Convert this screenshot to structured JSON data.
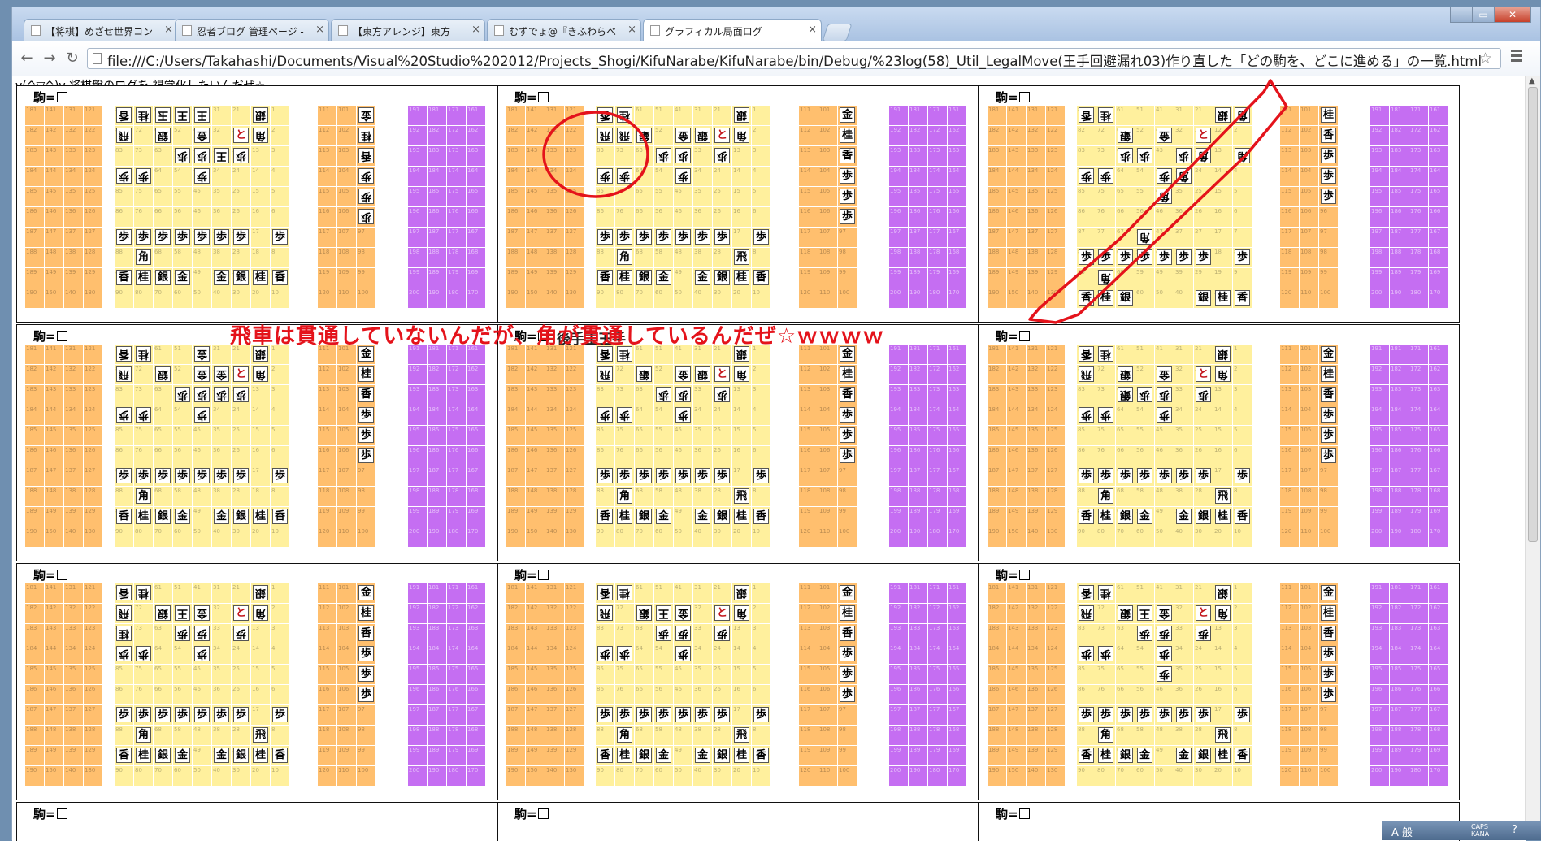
{
  "tabs": [
    {
      "label": "【将棋】めざせ世界コン",
      "active": false
    },
    {
      "label": "忍者ブログ 管理ページ -",
      "active": false
    },
    {
      "label": "【東方アレンジ】東方",
      "active": false
    },
    {
      "label": "むずでょ@『きふわらべ",
      "active": false
    },
    {
      "label": "グラフィカル局面ログ",
      "active": true
    }
  ],
  "address_bar": {
    "url": "file:///C:/Users/Takahashi/Documents/Visual%20Studio%202012/Projects_Shogi/KifuNarabe/KifuNarabe/bin/Debug/%23log(58)_Util_LegalMove(王手回避漏れ03)作り直した「どの駒を、どこに進める」の一覧.html"
  },
  "page": {
    "heading": "v(^▽^)v 将棋盤のログを 視覚化したいんだぜ☆",
    "annotation_text": "飛車は貫通していないんだが、角が貫通しているんだぜ☆ｗｗｗｗ",
    "koma_label": "駒=",
    "turn_label": "後手王王手"
  },
  "tray": {
    "ime": "A 般",
    "caps": "CAPS",
    "kana": "KANA",
    "help": "?"
  },
  "theme": {
    "orange": "#ffbf6e",
    "yellow": "#fff09d",
    "purple": "#c56ef2",
    "annotation_red": "#e4131b"
  },
  "grids": {
    "left_cols": [
      18,
      14,
      13,
      12
    ],
    "mid_cols": [
      11,
      10,
      9
    ],
    "right_cols": [
      19,
      18,
      17,
      16
    ]
  },
  "boards": [
    {
      "rows": [
        [
          "香r",
          "桂r",
          "玉r",
          "王r",
          "王r",
          "",
          "",
          "銀r",
          ""
        ],
        [
          "飛r",
          "",
          "銀r",
          "",
          "金r",
          "",
          "と",
          "角r",
          ""
        ],
        [
          "",
          "",
          "",
          "歩r",
          "歩r",
          "王r",
          "歩r",
          "",
          ""
        ],
        [
          "歩r",
          "歩r",
          "",
          "",
          "歩r",
          "",
          "",
          "",
          ""
        ],
        [
          "",
          "",
          "",
          "",
          "",
          "",
          "",
          "",
          ""
        ],
        [
          "",
          "",
          "",
          "",
          "",
          "",
          "",
          "",
          ""
        ],
        [
          "歩",
          "歩",
          "歩",
          "歩",
          "歩",
          "歩",
          "歩",
          "",
          "歩"
        ],
        [
          "",
          "角",
          "",
          "",
          "",
          "",
          "",
          "",
          ""
        ],
        [
          "香",
          "桂",
          "銀",
          "金",
          "",
          "金",
          "銀",
          "桂",
          "香"
        ]
      ]
    },
    {
      "rows": [
        [
          "香r",
          "桂r",
          "",
          "",
          "",
          "",
          "",
          "銀r",
          ""
        ],
        [
          "飛r",
          "飛r",
          "銀r",
          "",
          "金r",
          "銀r",
          "と",
          "角r",
          ""
        ],
        [
          "",
          "",
          "",
          "歩r",
          "歩r",
          "",
          "歩r",
          "",
          ""
        ],
        [
          "歩r",
          "歩r",
          "",
          "",
          "歩r",
          "",
          "",
          "",
          ""
        ],
        [
          "",
          "",
          "",
          "",
          "",
          "",
          "",
          "",
          ""
        ],
        [
          "",
          "",
          "",
          "",
          "",
          "",
          "",
          "",
          ""
        ],
        [
          "歩",
          "歩",
          "歩",
          "歩",
          "歩",
          "歩",
          "歩",
          "",
          "歩"
        ],
        [
          "",
          "角",
          "",
          "",
          "",
          "",
          "",
          "飛",
          ""
        ],
        [
          "香",
          "桂",
          "銀",
          "金",
          "",
          "金",
          "銀",
          "桂",
          "香"
        ]
      ]
    },
    {
      "rows": [
        [
          "香r",
          "桂r",
          "",
          "",
          "",
          "",
          "",
          "銀r",
          "角r"
        ],
        [
          "",
          "",
          "銀r",
          "",
          "金r",
          "",
          "と",
          "",
          ""
        ],
        [
          "",
          "",
          "歩r",
          "歩r",
          "",
          "歩r",
          "角r",
          "",
          "角r"
        ],
        [
          "歩r",
          "歩r",
          "",
          "",
          "歩r",
          "角r",
          "",
          "",
          ""
        ],
        [
          "",
          "",
          "",
          "",
          "角r",
          "",
          "",
          "",
          ""
        ],
        [
          "",
          "",
          "",
          "",
          "",
          "",
          "",
          "",
          ""
        ],
        [
          "",
          "",
          "",
          "角r",
          "",
          "",
          "",
          "",
          ""
        ],
        [
          "歩",
          "歩",
          "歩",
          "歩",
          "歩",
          "歩",
          "歩",
          "",
          "歩"
        ],
        [
          "",
          "角r",
          "",
          "",
          "",
          "",
          "",
          "",
          ""
        ],
        [
          "香",
          "桂",
          "銀",
          "",
          "",
          "",
          "銀",
          "桂",
          "香"
        ]
      ]
    },
    {
      "rows": [
        [
          "香r",
          "桂r",
          "",
          "",
          "金r",
          "",
          "",
          "銀r",
          ""
        ],
        [
          "飛r",
          "",
          "銀r",
          "",
          "金r",
          "金r",
          "と",
          "角r",
          ""
        ],
        [
          "",
          "",
          "",
          "歩r",
          "歩r",
          "歩r",
          "歩r",
          "",
          ""
        ],
        [
          "歩r",
          "歩r",
          "",
          "",
          "歩r",
          "",
          "",
          "",
          ""
        ],
        [
          "",
          "",
          "",
          "",
          "",
          "",
          "",
          "",
          ""
        ],
        [
          "",
          "",
          "",
          "",
          "",
          "",
          "",
          "",
          ""
        ],
        [
          "歩",
          "歩",
          "歩",
          "歩",
          "歩",
          "歩",
          "歩",
          "",
          "歩"
        ],
        [
          "",
          "角",
          "",
          "",
          "",
          "",
          "",
          "",
          ""
        ],
        [
          "香",
          "桂",
          "銀",
          "金",
          "",
          "金",
          "銀",
          "桂",
          "香"
        ]
      ]
    },
    {
      "rows": [
        [
          "香r",
          "桂r",
          "",
          "",
          "",
          "",
          "",
          "銀r",
          ""
        ],
        [
          "飛r",
          "",
          "銀r",
          "",
          "金r",
          "銀r",
          "と",
          "角r",
          ""
        ],
        [
          "",
          "",
          "",
          "歩r",
          "歩r",
          "",
          "歩r",
          "",
          ""
        ],
        [
          "歩r",
          "歩r",
          "",
          "",
          "歩r",
          "",
          "",
          "",
          ""
        ],
        [
          "",
          "",
          "",
          "",
          "",
          "",
          "",
          "",
          ""
        ],
        [
          "",
          "",
          "",
          "",
          "",
          "",
          "",
          "",
          ""
        ],
        [
          "歩",
          "歩",
          "歩",
          "歩",
          "歩",
          "歩",
          "歩",
          "",
          "歩"
        ],
        [
          "",
          "角",
          "",
          "",
          "",
          "",
          "",
          "飛",
          ""
        ],
        [
          "香",
          "桂",
          "銀",
          "金",
          "",
          "金",
          "銀",
          "桂",
          "香"
        ]
      ]
    },
    {
      "rows": [
        [
          "香r",
          "桂r",
          "",
          "",
          "",
          "",
          "",
          "銀r",
          ""
        ],
        [
          "飛r",
          "",
          "銀r",
          "",
          "金r",
          "",
          "と",
          "角r",
          ""
        ],
        [
          "",
          "",
          "銀r",
          "歩r",
          "歩r",
          "",
          "歩r",
          "",
          ""
        ],
        [
          "歩r",
          "歩r",
          "",
          "",
          "歩r",
          "",
          "",
          "",
          ""
        ],
        [
          "",
          "",
          "",
          "",
          "",
          "",
          "",
          "",
          ""
        ],
        [
          "",
          "",
          "",
          "",
          "",
          "",
          "",
          "",
          ""
        ],
        [
          "歩",
          "歩",
          "歩",
          "歩",
          "歩",
          "歩",
          "歩",
          "",
          "歩"
        ],
        [
          "",
          "角",
          "",
          "",
          "",
          "",
          "",
          "飛",
          ""
        ],
        [
          "香",
          "桂",
          "銀",
          "金",
          "",
          "金",
          "銀",
          "桂",
          "香"
        ]
      ]
    },
    {
      "rows": [
        [
          "香r",
          "桂r",
          "",
          "",
          "",
          "",
          "",
          "銀r",
          ""
        ],
        [
          "飛r",
          "",
          "銀r",
          "王r",
          "金r",
          "",
          "と",
          "角r",
          ""
        ],
        [
          "桂r",
          "",
          "",
          "歩r",
          "歩r",
          "",
          "歩r",
          "",
          ""
        ],
        [
          "歩r",
          "歩r",
          "",
          "",
          "歩r",
          "",
          "",
          "",
          ""
        ],
        [
          "",
          "",
          "",
          "",
          "",
          "",
          "",
          "",
          ""
        ],
        [
          "",
          "",
          "",
          "",
          "",
          "",
          "",
          "",
          ""
        ],
        [
          "歩",
          "歩",
          "歩",
          "歩",
          "歩",
          "歩",
          "歩",
          "",
          "歩"
        ],
        [
          "",
          "角",
          "",
          "",
          "",
          "",
          "",
          "飛",
          ""
        ],
        [
          "香",
          "桂",
          "銀",
          "金",
          "",
          "金",
          "銀",
          "桂",
          "香"
        ]
      ]
    },
    {
      "rows": [
        [
          "香r",
          "桂r",
          "",
          "",
          "",
          "",
          "",
          "銀r",
          ""
        ],
        [
          "飛r",
          "",
          "銀r",
          "王r",
          "金r",
          "",
          "と",
          "角r",
          ""
        ],
        [
          "",
          "",
          "",
          "歩r",
          "歩r",
          "",
          "歩r",
          "",
          ""
        ],
        [
          "歩r",
          "歩r",
          "",
          "",
          "歩r",
          "",
          "",
          "",
          ""
        ],
        [
          "",
          "",
          "",
          "",
          "",
          "",
          "",
          "",
          ""
        ],
        [
          "",
          "",
          "",
          "",
          "",
          "",
          "",
          "",
          ""
        ],
        [
          "歩",
          "歩",
          "歩",
          "歩",
          "歩",
          "歩",
          "歩",
          "",
          "歩"
        ],
        [
          "",
          "角",
          "",
          "",
          "",
          "",
          "",
          "飛",
          ""
        ],
        [
          "香",
          "桂",
          "銀",
          "金",
          "",
          "金",
          "銀",
          "桂",
          "香"
        ]
      ]
    },
    {
      "rows": [
        [
          "香r",
          "桂r",
          "",
          "",
          "",
          "",
          "",
          "銀r",
          ""
        ],
        [
          "飛r",
          "",
          "銀r",
          "王r",
          "金r",
          "",
          "と",
          "角r",
          ""
        ],
        [
          "",
          "",
          "",
          "歩r",
          "歩r",
          "",
          "歩r",
          "",
          ""
        ],
        [
          "歩r",
          "歩r",
          "",
          "",
          "歩r",
          "",
          "",
          "",
          ""
        ],
        [
          "",
          "",
          "",
          "",
          "歩r",
          "",
          "",
          "",
          ""
        ],
        [
          "",
          "",
          "",
          "",
          "",
          "",
          "",
          "",
          ""
        ],
        [
          "歩",
          "歩",
          "歩",
          "歩",
          "歩",
          "歩",
          "歩",
          "",
          "歩"
        ],
        [
          "",
          "角",
          "",
          "",
          "",
          "",
          "",
          "飛",
          ""
        ],
        [
          "香",
          "桂",
          "銀",
          "金",
          "",
          "金",
          "銀",
          "桂",
          "香"
        ]
      ]
    }
  ],
  "left_pieces": [
    {
      "cells": [
        "金r",
        "桂r",
        "香r",
        "歩r",
        "歩r",
        "歩r"
      ]
    },
    {
      "cells": [
        "金",
        "桂",
        "香",
        "歩",
        "歩",
        "歩"
      ]
    },
    {
      "cells": [
        "桂",
        "香",
        "歩",
        "歩",
        "歩"
      ]
    },
    {
      "cells": [
        "金",
        "桂",
        "香",
        "歩",
        "歩",
        "歩"
      ]
    },
    {
      "cells": [
        "金",
        "桂",
        "香",
        "歩",
        "歩",
        "歩"
      ]
    },
    {
      "cells": [
        "金",
        "桂",
        "香",
        "歩",
        "歩",
        "歩"
      ]
    },
    {
      "cells": [
        "金",
        "桂",
        "香",
        "歩",
        "歩",
        "歩"
      ]
    },
    {
      "cells": [
        "金",
        "桂",
        "香",
        "歩",
        "歩",
        "歩"
      ]
    },
    {
      "cells": [
        "金",
        "桂",
        "香",
        "歩",
        "歩",
        "歩"
      ]
    }
  ]
}
